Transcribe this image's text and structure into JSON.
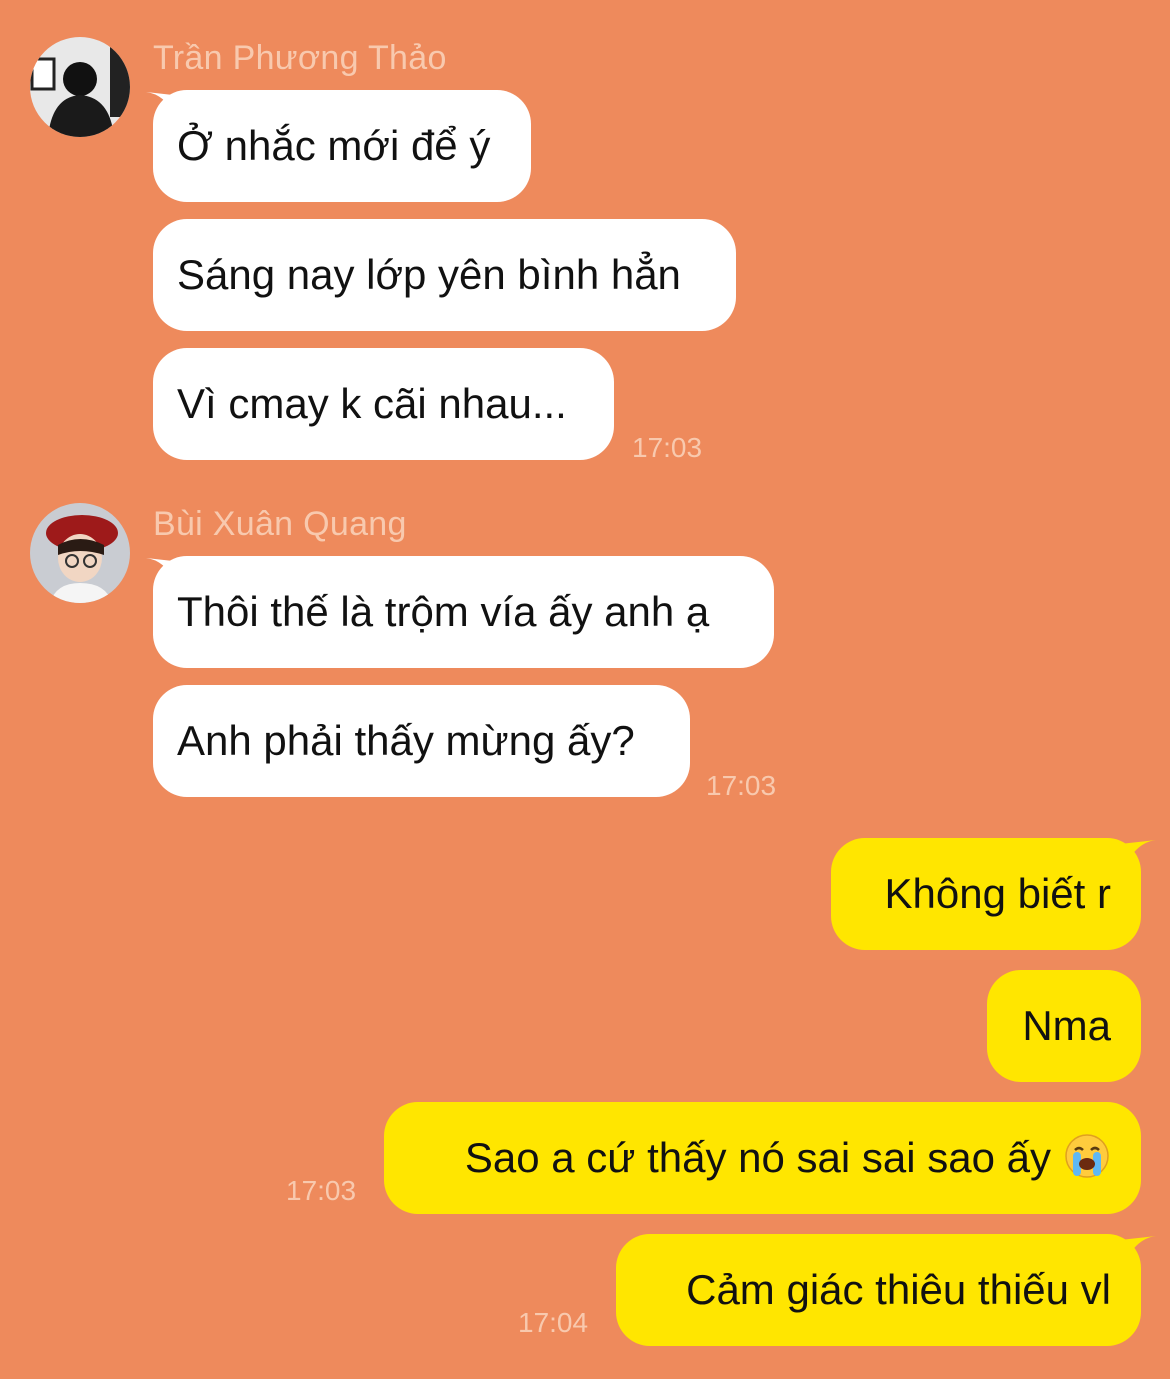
{
  "colors": {
    "background": "#ee8a5c",
    "incoming_bubble": "#ffffff",
    "outgoing_bubble": "#ffe600",
    "meta_text": "#f8c9ae"
  },
  "groups": [
    {
      "sender": "Trần Phương Thảo",
      "avatar_icon": "avatar-photo",
      "messages": [
        "Ở nhắc mới để ý",
        "Sáng nay lớp yên bình hẳn",
        "Vì cmay k cãi nhau..."
      ],
      "time": "17:03"
    },
    {
      "sender": "Bùi Xuân Quang",
      "avatar_icon": "avatar-photo",
      "messages": [
        "Thôi thế là trộm vía ấy anh ạ",
        "Anh phải thấy mừng ấy?"
      ],
      "time": "17:03"
    }
  ],
  "outgoing": {
    "messages": [
      "Không biết r",
      "Nma",
      "Sao a cứ thấy nó sai sai sao ấy",
      "Cảm giác thiêu thiếu vl"
    ],
    "emoji_icon": "loudly-crying-face-icon",
    "times": [
      "17:03",
      "17:04"
    ]
  }
}
